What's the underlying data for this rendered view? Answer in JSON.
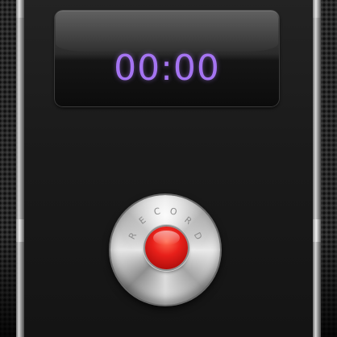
{
  "timer": {
    "display": "00:00"
  },
  "record_button": {
    "label_letters": [
      "R",
      "E",
      "C",
      "O",
      "R",
      "D"
    ]
  },
  "colors": {
    "timer_digits": "#a574f2",
    "record_red": "#e8201a",
    "background": "#1a1a1a"
  }
}
